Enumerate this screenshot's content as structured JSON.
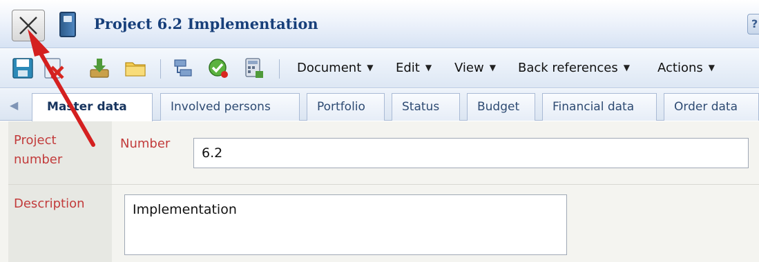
{
  "window": {
    "title": "Project 6.2 Implementation",
    "help_label": "?"
  },
  "toolbar": {
    "icons": [
      "save-icon",
      "discard-icon",
      "download-icon",
      "folder-icon",
      "transfer-icon",
      "approve-icon",
      "calculator-icon"
    ],
    "menus": [
      {
        "label": "Document",
        "caret": "▼"
      },
      {
        "label": "Edit",
        "caret": "▼"
      },
      {
        "label": "View",
        "caret": "▼"
      },
      {
        "label": "Back references",
        "caret": "▼"
      },
      {
        "label": "Actions",
        "caret": "▼"
      }
    ]
  },
  "tabs": [
    {
      "label": "Master data",
      "active": true
    },
    {
      "label": "Involved persons",
      "active": false
    },
    {
      "label": "Portfolio",
      "active": false
    },
    {
      "label": "Status",
      "active": false
    },
    {
      "label": "Budget",
      "active": false
    },
    {
      "label": "Financial data",
      "active": false
    },
    {
      "label": "Order data",
      "active": false
    }
  ],
  "form": {
    "project_number": {
      "section_label_line1": "Project",
      "section_label_line2": "number",
      "field_label": "Number",
      "value": "6.2"
    },
    "description": {
      "section_label": "Description",
      "value": "Implementation"
    }
  },
  "colors": {
    "title_text": "#173f7a",
    "label_red": "#c23b3b",
    "annotation_arrow": "#d42020"
  }
}
